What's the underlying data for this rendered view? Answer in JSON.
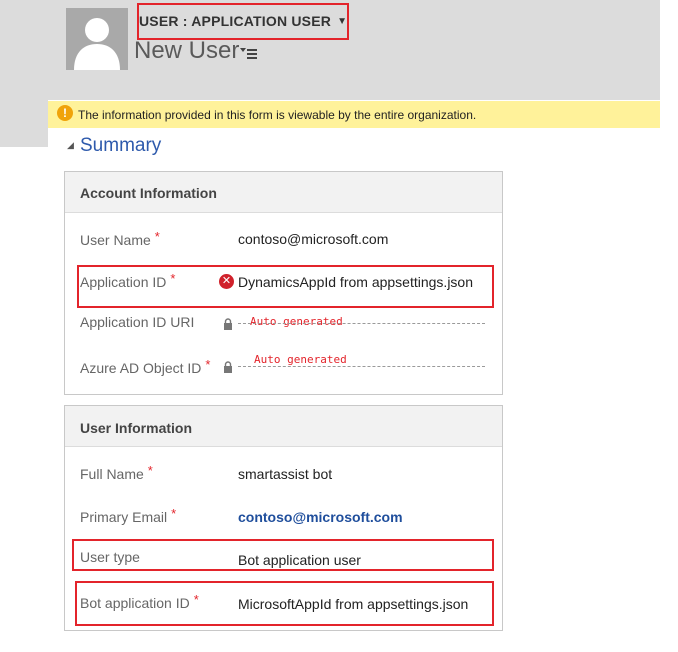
{
  "header": {
    "form_type": "USER : APPLICATION USER",
    "entity_title": "New User"
  },
  "notification": {
    "text": "The information provided in this form is viewable by the entire organization."
  },
  "summary": {
    "title": "Summary"
  },
  "account_info": {
    "title": "Account Information",
    "user_name_label": "User Name",
    "user_name_value": "contoso@microsoft.com",
    "app_id_label": "Application ID",
    "app_id_value": "DynamicsAppId from appsettings.json",
    "app_id_uri_label": "Application ID URI",
    "app_id_uri_value": "Auto generated",
    "azure_ad_label": "Azure AD Object ID",
    "azure_ad_value": "Auto generated"
  },
  "user_info": {
    "title": "User Information",
    "full_name_label": "Full Name",
    "full_name_value": "smartassist bot",
    "email_label": "Primary Email",
    "email_value": "contoso@microsoft.com",
    "user_type_label": "User type",
    "user_type_value": "Bot application user",
    "bot_app_id_label": "Bot application ID",
    "bot_app_id_value": "MicrosoftAppId from appsettings.json"
  },
  "colors": {
    "highlight": "#e3242b",
    "accent": "#2e5aac",
    "notification_bg": "#fff29a"
  },
  "icons": [
    "avatar-icon",
    "dropdown-caret-icon",
    "nav-menu-icon",
    "warning-icon",
    "collapse-icon",
    "error-icon",
    "lock-icon"
  ]
}
